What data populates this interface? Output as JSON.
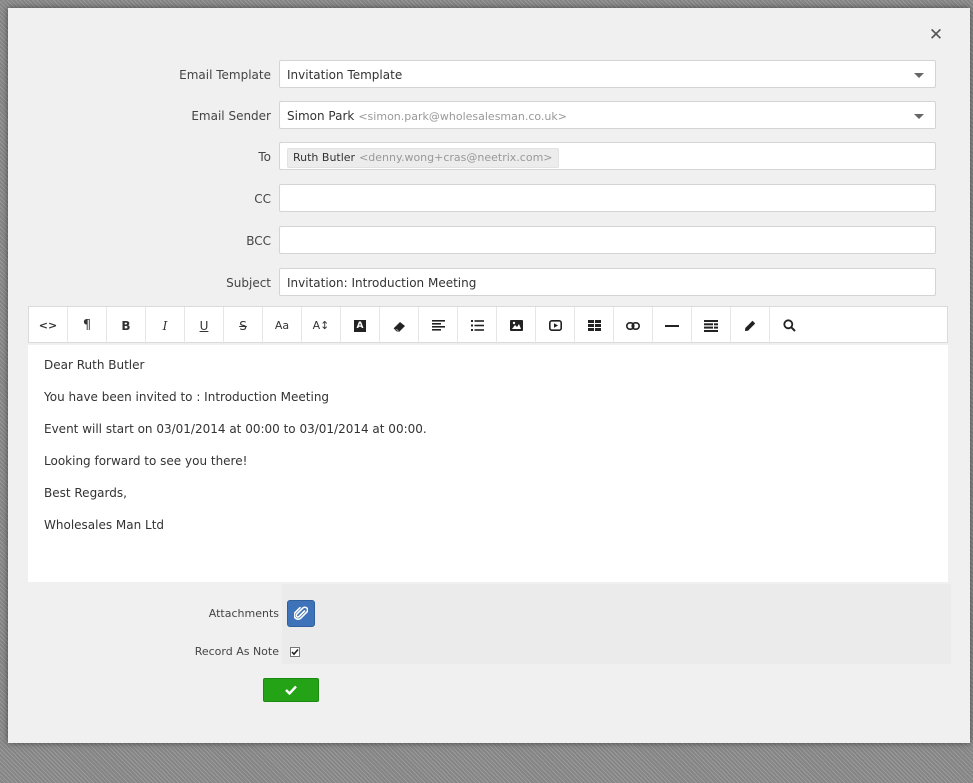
{
  "form": {
    "template_label": "Email Template",
    "template_value": "Invitation Template",
    "sender_label": "Email Sender",
    "sender_name": "Simon Park",
    "sender_email": "<simon.park@wholesalesman.co.uk>",
    "to_label": "To",
    "to_name": "Ruth Butler",
    "to_email": "<denny.wong+cras@neetrix.com>",
    "cc_label": "CC",
    "cc_value": "",
    "bcc_label": "BCC",
    "bcc_value": "",
    "subject_label": "Subject",
    "subject_value": "Invitation: Introduction Meeting"
  },
  "toolbar": {
    "buttons": [
      {
        "name": "code-view",
        "glyph": "<>"
      },
      {
        "name": "paragraph",
        "glyph": "¶"
      },
      {
        "name": "bold",
        "glyph": "B"
      },
      {
        "name": "italic",
        "glyph": "I"
      },
      {
        "name": "underline",
        "glyph": "U"
      },
      {
        "name": "strikethrough",
        "glyph": "S"
      },
      {
        "name": "font-size",
        "glyph": "Aa"
      },
      {
        "name": "line-height",
        "glyph": "A↕"
      },
      {
        "name": "font-color",
        "glyph": "A"
      },
      {
        "name": "eraser",
        "glyph": "eraser-icon"
      },
      {
        "name": "align",
        "glyph": "align-icon"
      },
      {
        "name": "list",
        "glyph": "list-icon"
      },
      {
        "name": "image",
        "glyph": "image-icon"
      },
      {
        "name": "video",
        "glyph": "video-icon"
      },
      {
        "name": "table",
        "glyph": "table-icon"
      },
      {
        "name": "link",
        "glyph": "link-icon"
      },
      {
        "name": "horizontal-rule",
        "glyph": "—"
      },
      {
        "name": "template",
        "glyph": "template-icon"
      },
      {
        "name": "pencil",
        "glyph": "pencil-icon"
      },
      {
        "name": "search",
        "glyph": "search-icon"
      }
    ]
  },
  "editor": {
    "lines": [
      "Dear Ruth Butler",
      "You have been invited to : Introduction Meeting",
      "Event will start on 03/01/2014 at 00:00 to 03/01/2014 at 00:00.",
      "Looking forward to see you there!",
      "Best Regards,",
      "Wholesales Man Ltd"
    ]
  },
  "footer": {
    "attachments_label": "Attachments",
    "record_note_label": "Record As Note",
    "record_note_checked": true
  },
  "colors": {
    "attach_button": "#3e73b9",
    "submit_button": "#23a315"
  }
}
